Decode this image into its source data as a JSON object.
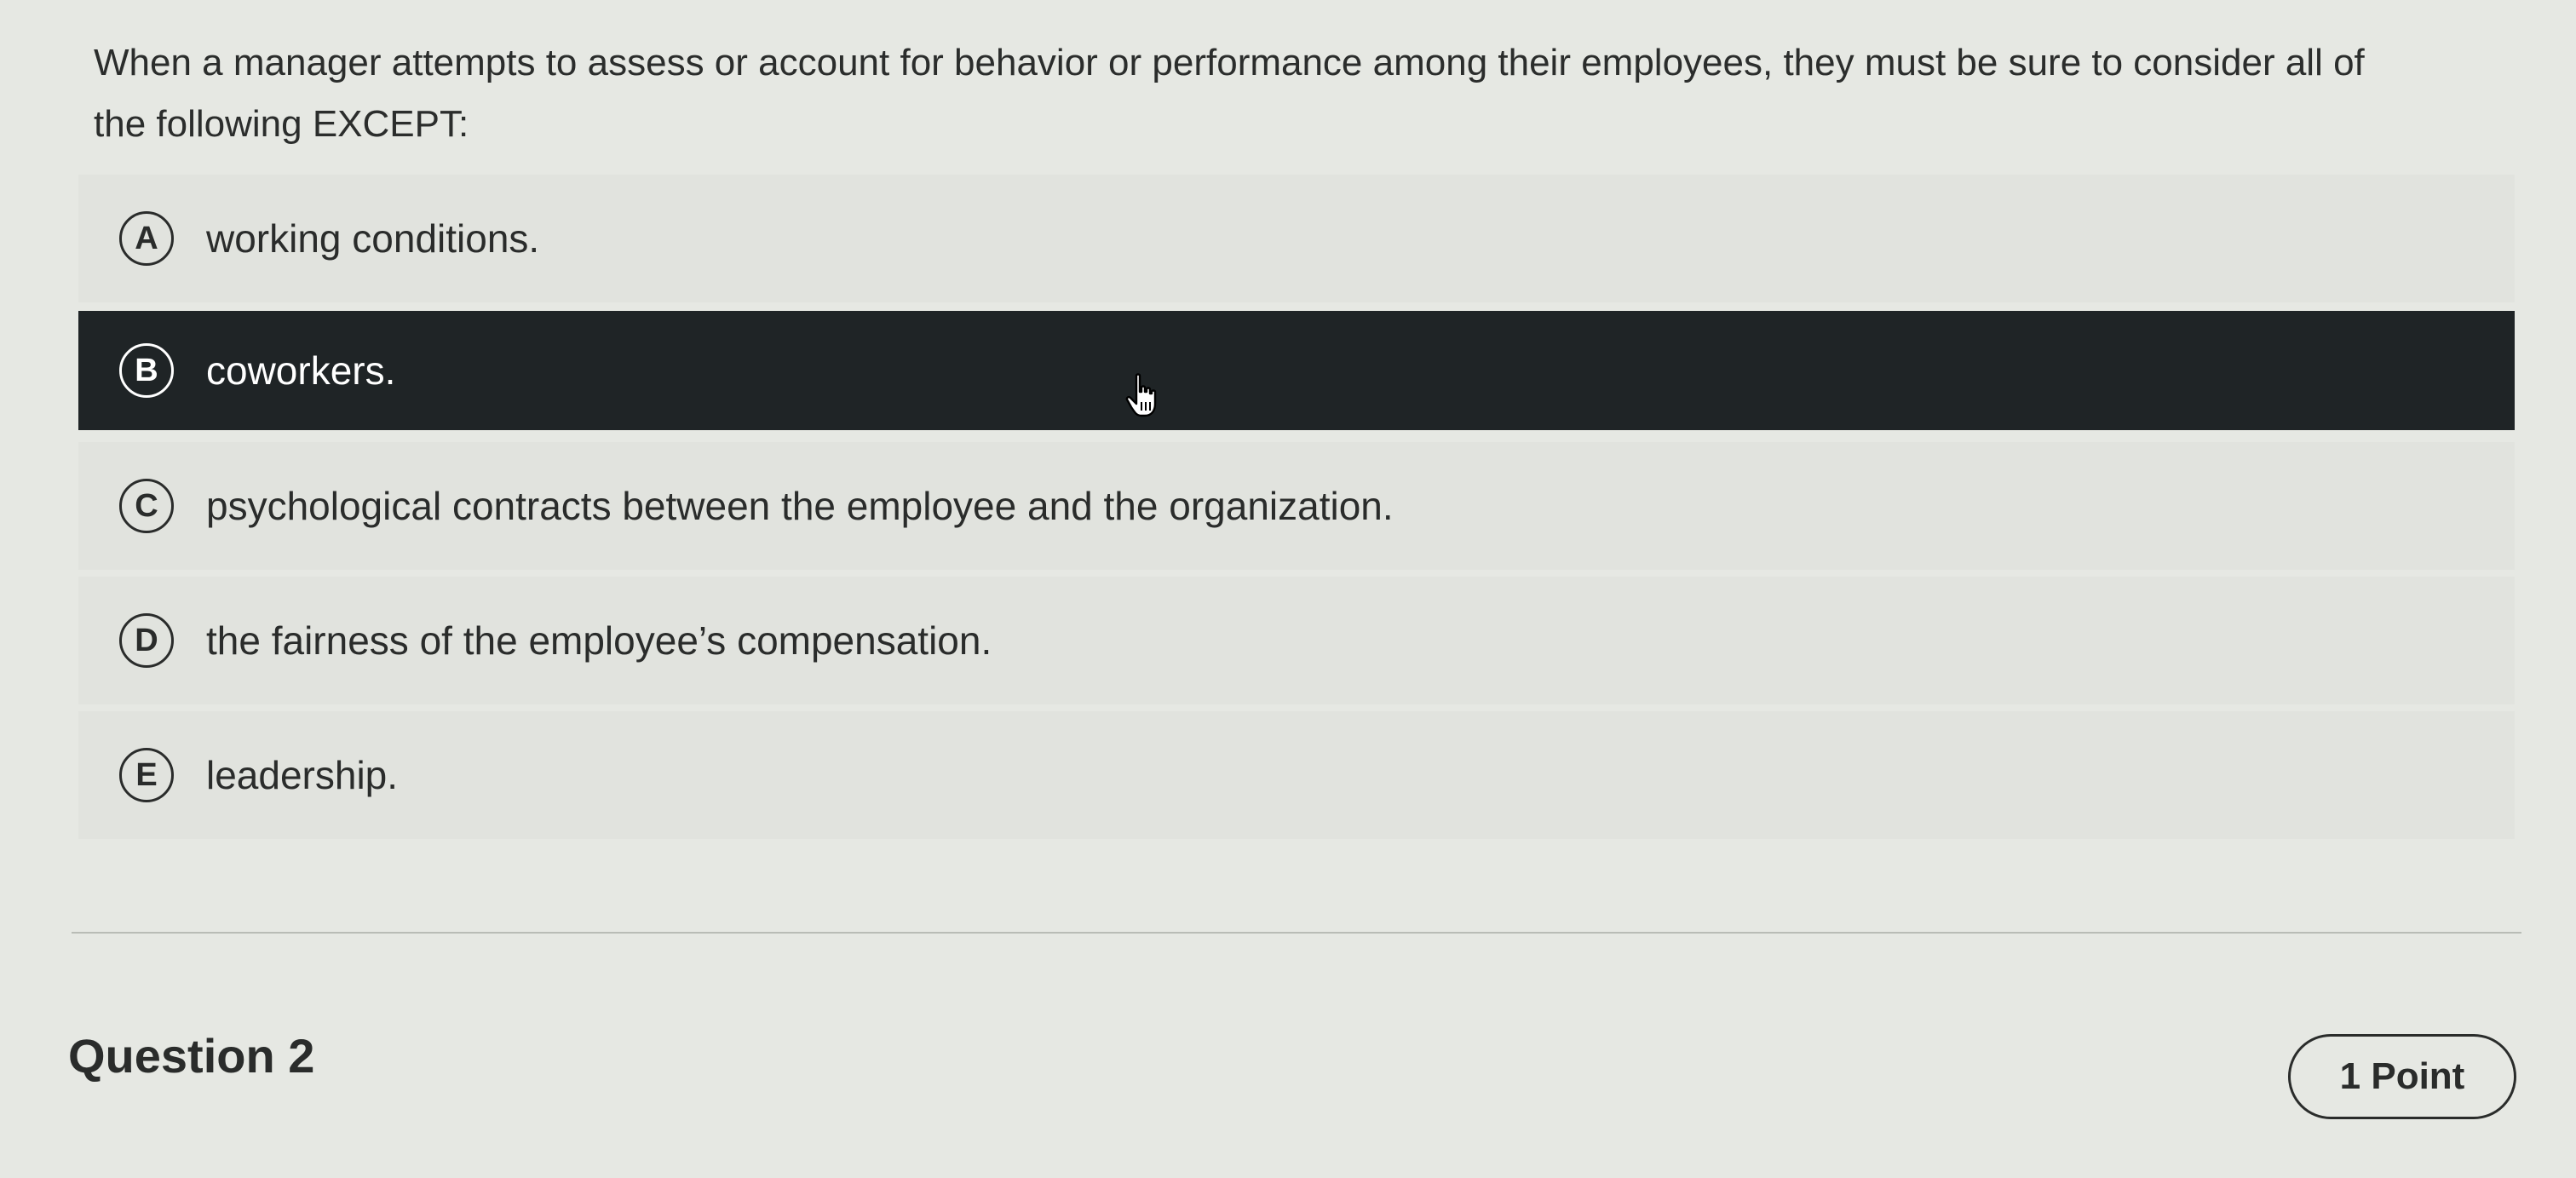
{
  "question": {
    "text": "When a manager attempts to assess or account for behavior or performance among their employees, they must be sure to consider all of the following EXCEPT:"
  },
  "options": [
    {
      "letter": "A",
      "label": "working conditions."
    },
    {
      "letter": "B",
      "label": "coworkers.",
      "selected": true
    },
    {
      "letter": "C",
      "label": "psychological contracts between the employee and the organization."
    },
    {
      "letter": "D",
      "label": "the fairness of the employee’s compensation."
    },
    {
      "letter": "E",
      "label": "leadership."
    }
  ],
  "next_question": {
    "title": "Question 2",
    "points": "1 Point"
  },
  "icons": {
    "cursor": "hand-pointer-icon"
  },
  "colors": {
    "selected_background": "#1f2426",
    "page_background": "#e6e8e3"
  }
}
